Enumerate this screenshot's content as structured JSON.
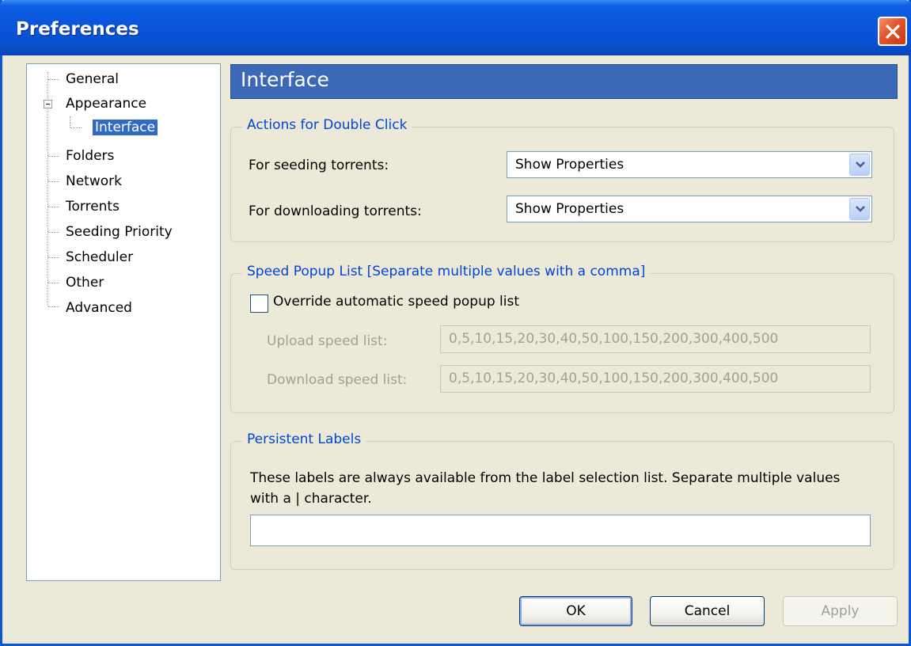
{
  "window": {
    "title": "Preferences"
  },
  "tree": {
    "items": [
      {
        "label": "General"
      },
      {
        "label": "Appearance"
      },
      {
        "label": "Interface"
      },
      {
        "label": "Folders"
      },
      {
        "label": "Network"
      },
      {
        "label": "Torrents"
      },
      {
        "label": "Seeding Priority"
      },
      {
        "label": "Scheduler"
      },
      {
        "label": "Other"
      },
      {
        "label": "Advanced"
      }
    ],
    "selected": "Interface"
  },
  "page": {
    "title": "Interface",
    "double_click": {
      "legend": "Actions for Double Click",
      "seeding_label": "For seeding torrents:",
      "seeding_value": "Show Properties",
      "downloading_label": "For downloading torrents:",
      "downloading_value": "Show Properties"
    },
    "speed_popup": {
      "legend": "Speed Popup List [Separate multiple values with a comma]",
      "override_label": "Override automatic speed popup list",
      "override_checked": false,
      "upload_label": "Upload speed list:",
      "upload_value": "0,5,10,15,20,30,40,50,100,150,200,300,400,500",
      "download_label": "Download speed list:",
      "download_value": "0,5,10,15,20,30,40,50,100,150,200,300,400,500"
    },
    "persistent_labels": {
      "legend": "Persistent Labels",
      "description": "These labels are always available from the label selection list. Separate multiple values with a | character.",
      "value": ""
    }
  },
  "buttons": {
    "ok": "OK",
    "cancel": "Cancel",
    "apply": "Apply"
  },
  "colors": {
    "title_bar": "#0a55da",
    "header": "#3b69b8",
    "legend": "#0046d5",
    "selection": "#316ac5"
  }
}
